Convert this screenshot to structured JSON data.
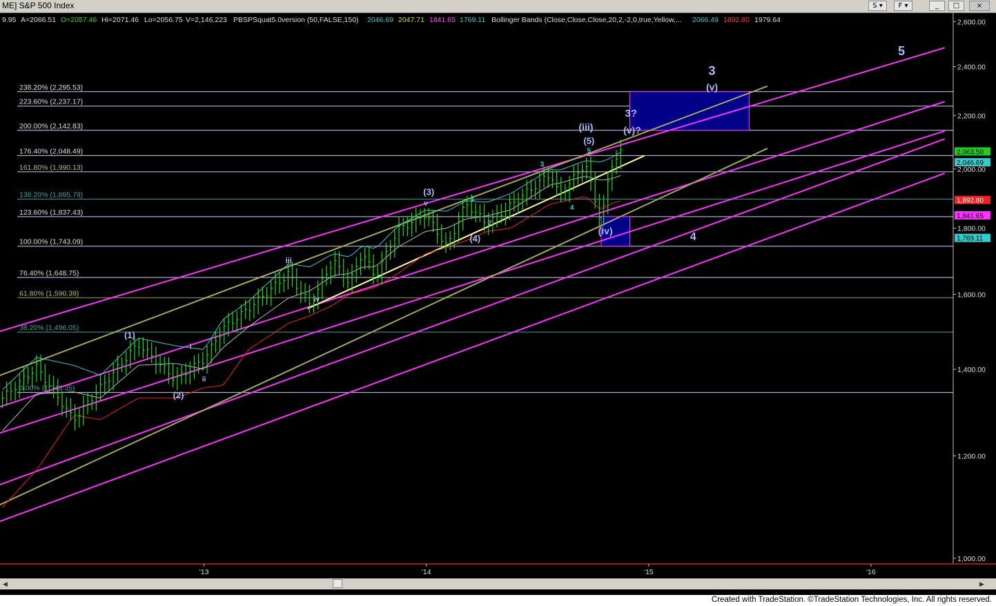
{
  "window": {
    "title": "ME] S&P 500 Index",
    "buttons": [
      "S",
      "F",
      "_",
      "□",
      "×"
    ]
  },
  "info_bar": {
    "close": "9.95",
    "ask": "A=2066.51",
    "open": "O=2057.46",
    "high": "Hi=2071.46",
    "low": "Lo=2056.75",
    "volume": "V=2,146,223",
    "indicator1_name": "PBSPSquat5.0version (50,FALSE,150)",
    "indicator1_values": [
      "2046.69",
      "2047.71",
      "1841.65",
      "1769.11"
    ],
    "indicator2_name": "Bollinger Bands (Close,Close,Close,20,2,-2,0,true,Yellow,...",
    "indicator2_values": [
      "2066.49",
      "1892.80",
      "1979.64"
    ],
    "colors": {
      "close": "#dddddd",
      "ask": "#dddddd",
      "open": "#22dd22",
      "high": "#dddddd",
      "low": "#dddddd",
      "volume": "#dddddd",
      "ind1_name": "#dddddd",
      "ind1_vals": [
        "#33cccc",
        "#dddd00",
        "#ff44ff",
        "#33cccc"
      ],
      "ind2_name": "#dddddd",
      "ind2_vals": [
        "#33cccc",
        "#ff3333",
        "#dddddd"
      ]
    }
  },
  "chart_data": {
    "type": "ohlc",
    "x_axis": {
      "type": "date",
      "range": [
        "2012-02-01",
        "2016-05-15"
      ],
      "ticks": [
        {
          "date": "2013-01-01",
          "label": "'13"
        },
        {
          "date": "2014-01-01",
          "label": "'14"
        },
        {
          "date": "2015-01-01",
          "label": "'15"
        },
        {
          "date": "2016-01-01",
          "label": "'16"
        }
      ]
    },
    "y_axis": {
      "scale": "log",
      "range": [
        990,
        2640
      ],
      "ticks": [
        {
          "value": 1000,
          "label": "1,000.00"
        },
        {
          "value": 1200,
          "label": "1,200.00"
        },
        {
          "value": 1400,
          "label": "1,400.00"
        },
        {
          "value": 1600,
          "label": "1,600.00"
        },
        {
          "value": 1800,
          "label": "1,800.00"
        },
        {
          "value": 2000,
          "label": "2,000.00"
        },
        {
          "value": 2200,
          "label": "2,200.00"
        },
        {
          "value": 2400,
          "label": "2,400.00"
        },
        {
          "value": 2600,
          "label": "2,600.00"
        }
      ]
    },
    "fib_levels": [
      {
        "label": "238.20% (2,295.53)",
        "value": 2295.53,
        "color": "#cfcfff",
        "text_color": "#dddddd"
      },
      {
        "label": "223.60% (2,237.17)",
        "value": 2237.17,
        "color": "#cfcfff",
        "text_color": "#dddddd"
      },
      {
        "label": "200.00% (2,142.83)",
        "value": 2142.83,
        "color": "#cfcfff",
        "text_color": "#dddddd"
      },
      {
        "label": "176.40% (2,048.49)",
        "value": 2048.49,
        "color": "#cfcfff",
        "text_color": "#dddddd"
      },
      {
        "label": "161.80% (1,990.13)",
        "value": 1990.13,
        "color": "#cfcfff",
        "text_color": "#b8b870"
      },
      {
        "label": "138.20% (1,895.79)",
        "value": 1895.79,
        "color": "#40a0a0",
        "text_color": "#40a0a0"
      },
      {
        "label": "123.60% (1,837.43)",
        "value": 1837.43,
        "color": "#cfcfff",
        "text_color": "#dddddd"
      },
      {
        "label": "100.00% (1,743.09)",
        "value": 1743.09,
        "color": "#cfcfff",
        "text_color": "#dddddd"
      },
      {
        "label": "76.40% (1,648.75)",
        "value": 1648.75,
        "color": "#cfcfff",
        "text_color": "#dddddd"
      },
      {
        "label": "61.80% (1,590.39)",
        "value": 1590.39,
        "color": "#9a9a50",
        "text_color": "#b8b870"
      },
      {
        "label": "38.20% (1,496.05)",
        "value": 1496.05,
        "color": "#40a0a0",
        "text_color": "#40a0a0"
      },
      {
        "label": "0.00% (1,343.35)",
        "value": 1343.35,
        "color": "#cfcfff",
        "text_color": "#40a0a0"
      }
    ],
    "price_tags": [
      {
        "label": "2,063.50",
        "value": 2063.5,
        "bg": "#22cc22",
        "fg": "#000000"
      },
      {
        "label": "2,046.69",
        "value": 2046.69,
        "bg": "#33cccc",
        "fg": "#000000"
      },
      {
        "label": "1,892.80",
        "value": 1892.8,
        "bg": "#ee2222",
        "fg": "#ffffff"
      },
      {
        "label": "1,841.65",
        "value": 1841.65,
        "bg": "#ff33ff",
        "fg": "#000000"
      },
      {
        "label": "1,769.11",
        "value": 1769.11,
        "bg": "#33cccc",
        "fg": "#000000"
      }
    ],
    "boxes": [
      {
        "x0": "2014-12-01",
        "x1": "2015-06-15",
        "y0": 2142.83,
        "y1": 2295.53,
        "fill": "#000088",
        "stroke": "#ff33ff"
      },
      {
        "x0": "2014-10-15",
        "x1": "2014-12-01",
        "y0": 1743.09,
        "y1": 1837.43,
        "fill": "#000088",
        "stroke": "#ff33ff"
      }
    ],
    "trend_lines": [
      {
        "color": "#ff33ff",
        "points": [
          [
            "2012-02-01",
            1498
          ],
          [
            "2016-05-01",
            2482
          ]
        ]
      },
      {
        "color": "#ff33ff",
        "points": [
          [
            "2012-02-01",
            1310
          ],
          [
            "2016-05-01",
            2255
          ]
        ]
      },
      {
        "color": "#ff33ff",
        "points": [
          [
            "2012-02-01",
            1250
          ],
          [
            "2016-05-01",
            2140
          ]
        ]
      },
      {
        "color": "#ff33ff",
        "points": [
          [
            "2012-02-01",
            1140
          ],
          [
            "2016-05-01",
            2110
          ]
        ]
      },
      {
        "color": "#ff33ff",
        "points": [
          [
            "2012-02-01",
            1068
          ],
          [
            "2016-05-01",
            1985
          ]
        ]
      },
      {
        "color": "#a8a860",
        "points": [
          [
            "2012-02-01",
            1385
          ],
          [
            "2015-07-15",
            2318
          ]
        ]
      },
      {
        "color": "#a8a860",
        "points": [
          [
            "2012-02-01",
            1100
          ],
          [
            "2015-07-15",
            2075
          ]
        ]
      },
      {
        "color": "#ffffa0",
        "points": [
          [
            "2013-06-20",
            1560
          ],
          [
            "2014-12-25",
            2048
          ]
        ]
      }
    ],
    "price_series": {
      "color": "#22dd22",
      "anchors": [
        [
          "2012-02-05",
          1330
        ],
        [
          "2012-04-01",
          1405
        ],
        [
          "2012-06-01",
          1280
        ],
        [
          "2012-07-15",
          1355
        ],
        [
          "2012-09-15",
          1465
        ],
        [
          "2012-11-15",
          1375
        ],
        [
          "2013-01-01",
          1425
        ],
        [
          "2013-02-01",
          1505
        ],
        [
          "2013-03-15",
          1560
        ],
        [
          "2013-05-20",
          1660
        ],
        [
          "2013-06-24",
          1570
        ],
        [
          "2013-08-01",
          1700
        ],
        [
          "2013-08-28",
          1632
        ],
        [
          "2013-09-18",
          1725
        ],
        [
          "2013-10-09",
          1650
        ],
        [
          "2013-11-15",
          1795
        ],
        [
          "2013-12-31",
          1845
        ],
        [
          "2014-02-04",
          1740
        ],
        [
          "2014-03-07",
          1880
        ],
        [
          "2014-04-11",
          1815
        ],
        [
          "2014-05-20",
          1875
        ],
        [
          "2014-07-24",
          1985
        ],
        [
          "2014-08-07",
          1905
        ],
        [
          "2014-09-19",
          2020
        ],
        [
          "2014-10-15",
          1820
        ],
        [
          "2014-10-31",
          2015
        ],
        [
          "2014-11-20",
          2068
        ]
      ]
    },
    "bollinger_upper": {
      "color": "#33cccc",
      "anchors": [
        [
          "2012-02-05",
          1350
        ],
        [
          "2012-04-01",
          1430
        ],
        [
          "2012-06-01",
          1410
        ],
        [
          "2012-07-15",
          1385
        ],
        [
          "2012-09-15",
          1480
        ],
        [
          "2012-11-15",
          1460
        ],
        [
          "2013-01-01",
          1450
        ],
        [
          "2013-02-01",
          1530
        ],
        [
          "2013-03-15",
          1580
        ],
        [
          "2013-05-20",
          1690
        ],
        [
          "2013-06-24",
          1680
        ],
        [
          "2013-08-01",
          1720
        ],
        [
          "2013-08-28",
          1710
        ],
        [
          "2013-09-18",
          1745
        ],
        [
          "2013-10-09",
          1735
        ],
        [
          "2013-11-15",
          1805
        ],
        [
          "2013-12-31",
          1860
        ],
        [
          "2014-02-04",
          1855
        ],
        [
          "2014-03-07",
          1890
        ],
        [
          "2014-04-11",
          1885
        ],
        [
          "2014-05-20",
          1915
        ],
        [
          "2014-07-24",
          2000
        ],
        [
          "2014-08-07",
          1995
        ],
        [
          "2014-09-19",
          2030
        ],
        [
          "2014-10-15",
          2025
        ],
        [
          "2014-10-31",
          2040
        ],
        [
          "2014-11-20",
          2066
        ]
      ]
    },
    "bollinger_mid": {
      "color": "#bbbbbb",
      "anchors": [
        [
          "2012-02-05",
          1255
        ],
        [
          "2012-04-01",
          1340
        ],
        [
          "2012-06-01",
          1345
        ],
        [
          "2012-07-15",
          1330
        ],
        [
          "2012-09-15",
          1410
        ],
        [
          "2012-11-15",
          1415
        ],
        [
          "2013-01-01",
          1400
        ],
        [
          "2013-02-01",
          1455
        ],
        [
          "2013-03-15",
          1510
        ],
        [
          "2013-05-20",
          1590
        ],
        [
          "2013-06-24",
          1610
        ],
        [
          "2013-08-01",
          1655
        ],
        [
          "2013-08-28",
          1660
        ],
        [
          "2013-09-18",
          1680
        ],
        [
          "2013-10-09",
          1680
        ],
        [
          "2013-11-15",
          1740
        ],
        [
          "2013-12-31",
          1790
        ],
        [
          "2014-02-04",
          1800
        ],
        [
          "2014-03-07",
          1830
        ],
        [
          "2014-04-11",
          1840
        ],
        [
          "2014-05-20",
          1860
        ],
        [
          "2014-07-24",
          1945
        ],
        [
          "2014-08-07",
          1950
        ],
        [
          "2014-09-19",
          1975
        ],
        [
          "2014-10-15",
          1960
        ],
        [
          "2014-10-31",
          1965
        ],
        [
          "2014-11-20",
          1980
        ]
      ]
    },
    "bollinger_lower": {
      "color": "#ee2222",
      "anchors": [
        [
          "2012-02-05",
          1095
        ],
        [
          "2012-04-01",
          1170
        ],
        [
          "2012-06-01",
          1290
        ],
        [
          "2012-07-15",
          1280
        ],
        [
          "2012-09-15",
          1330
        ],
        [
          "2012-11-15",
          1330
        ],
        [
          "2013-01-01",
          1355
        ],
        [
          "2013-02-01",
          1360
        ],
        [
          "2013-03-15",
          1450
        ],
        [
          "2013-05-20",
          1520
        ],
        [
          "2013-06-24",
          1540
        ],
        [
          "2013-08-01",
          1570
        ],
        [
          "2013-08-28",
          1600
        ],
        [
          "2013-09-18",
          1610
        ],
        [
          "2013-10-09",
          1620
        ],
        [
          "2013-11-15",
          1660
        ],
        [
          "2013-12-31",
          1720
        ],
        [
          "2014-02-04",
          1740
        ],
        [
          "2014-03-07",
          1760
        ],
        [
          "2014-04-11",
          1790
        ],
        [
          "2014-05-20",
          1800
        ],
        [
          "2014-07-24",
          1880
        ],
        [
          "2014-08-07",
          1885
        ],
        [
          "2014-09-19",
          1905
        ],
        [
          "2014-10-15",
          1860
        ],
        [
          "2014-10-31",
          1880
        ],
        [
          "2014-11-20",
          1892.8
        ]
      ]
    },
    "wave_labels": [
      {
        "text": "(1)",
        "date": "2012-09-01",
        "value": 1480,
        "color": "#aabbff",
        "size": 13
      },
      {
        "text": "(2)",
        "date": "2012-11-20",
        "value": 1330,
        "color": "#aabbff",
        "size": 13
      },
      {
        "text": "i",
        "date": "2012-12-10",
        "value": 1452,
        "color": "#aabbff",
        "size": 10
      },
      {
        "text": "ii",
        "date": "2013-01-01",
        "value": 1370,
        "color": "#aabbff",
        "size": 10
      },
      {
        "text": "iii",
        "date": "2013-05-20",
        "value": 1692,
        "color": "#aabbff",
        "size": 11
      },
      {
        "text": "iv",
        "date": "2013-07-05",
        "value": 1580,
        "color": "#aabbff",
        "size": 10
      },
      {
        "text": "v",
        "date": "2013-12-31",
        "value": 1875,
        "color": "#aabbff",
        "size": 10
      },
      {
        "text": "(3)",
        "date": "2014-01-05",
        "value": 1910,
        "color": "#aabbff",
        "size": 13
      },
      {
        "text": "1",
        "date": "2014-03-18",
        "value": 1890,
        "color": "#33cccc",
        "size": 10
      },
      {
        "text": "2",
        "date": "2014-04-15",
        "value": 1810,
        "color": "#33cccc",
        "size": 10
      },
      {
        "text": "(4)",
        "date": "2014-03-22",
        "value": 1758,
        "color": "#aabbff",
        "size": 13
      },
      {
        "text": "3",
        "date": "2014-07-10",
        "value": 2010,
        "color": "#33cccc",
        "size": 10
      },
      {
        "text": "4",
        "date": "2014-08-28",
        "value": 1860,
        "color": "#33cccc",
        "size": 10
      },
      {
        "text": "5",
        "date": "2014-09-25",
        "value": 2058,
        "color": "#33cccc",
        "size": 10
      },
      {
        "text": "(5)",
        "date": "2014-09-25",
        "value": 2092,
        "color": "#aabbff",
        "size": 13
      },
      {
        "text": "(iii)",
        "date": "2014-09-20",
        "value": 2142,
        "color": "#aabbff",
        "size": 14
      },
      {
        "text": "(iv)",
        "date": "2014-10-22",
        "value": 1780,
        "color": "#aabbff",
        "size": 14
      },
      {
        "text": "3?",
        "date": "2014-12-03",
        "value": 2195,
        "color": "#aabbff",
        "size": 15
      },
      {
        "text": "(v)?",
        "date": "2014-12-05",
        "value": 2130,
        "color": "#aabbff",
        "size": 14
      },
      {
        "text": "3",
        "date": "2015-04-15",
        "value": 2365,
        "color": "#aabbff",
        "size": 18
      },
      {
        "text": "(v)",
        "date": "2015-04-15",
        "value": 2300,
        "color": "#aabbff",
        "size": 14
      },
      {
        "text": "4",
        "date": "2015-03-15",
        "value": 1762,
        "color": "#aabbff",
        "size": 16
      },
      {
        "text": "5",
        "date": "2016-02-20",
        "value": 2450,
        "color": "#aabbff",
        "size": 18
      }
    ]
  },
  "footer": {
    "credit": "Created with TradeStation. ©TradeStation Technologies, Inc. All rights reserved."
  }
}
